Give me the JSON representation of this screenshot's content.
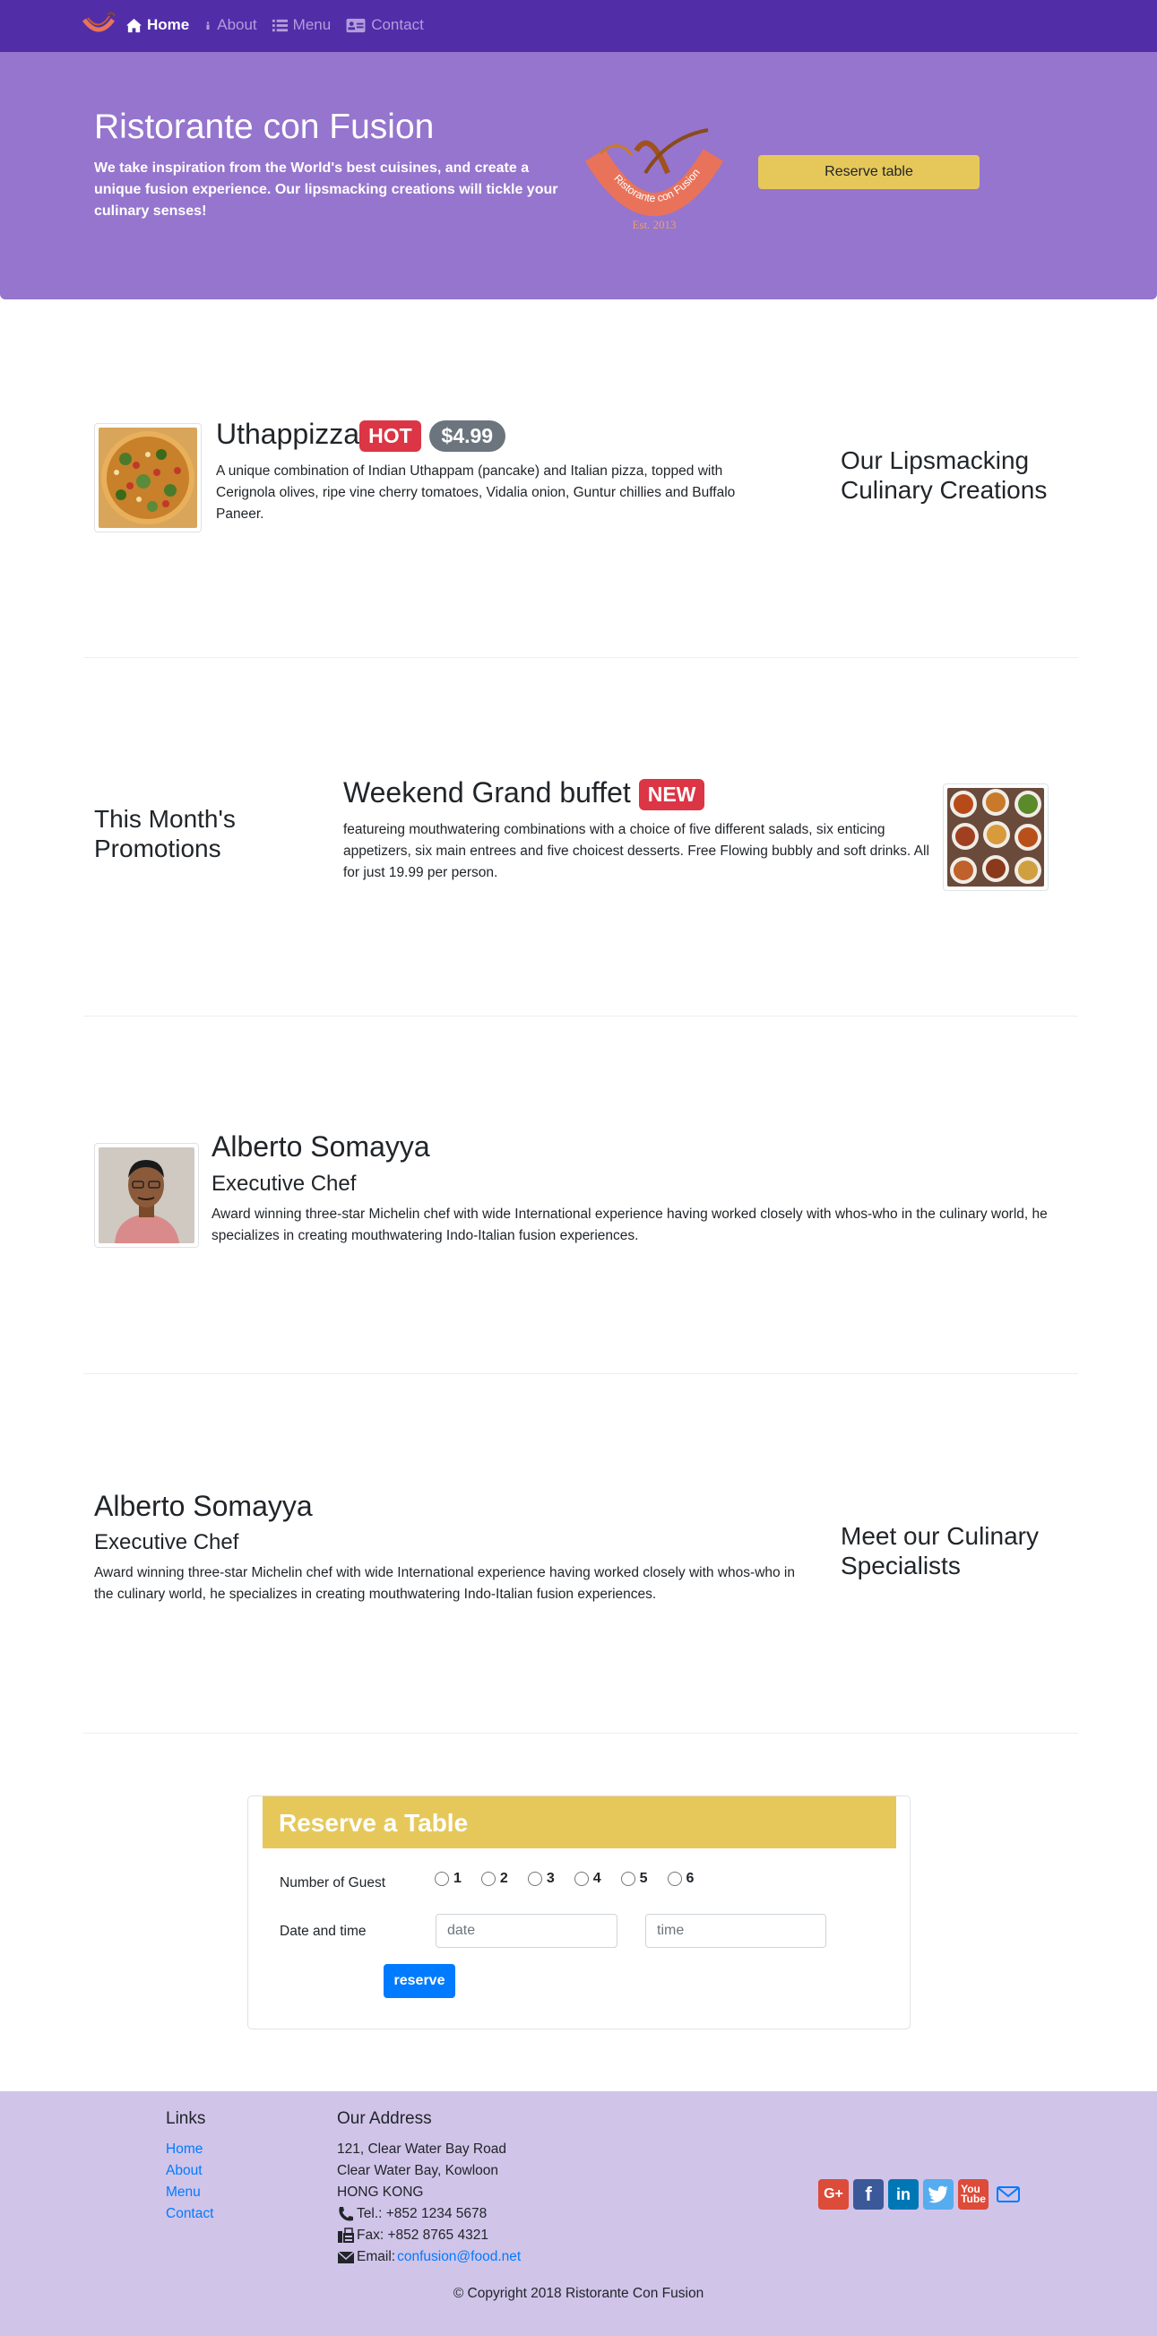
{
  "nav": {
    "items": [
      {
        "label": "Home",
        "icon": "home-icon"
      },
      {
        "label": "About",
        "icon": "info-icon"
      },
      {
        "label": "Menu",
        "icon": "list-icon"
      },
      {
        "label": "Contact",
        "icon": "address-card-icon"
      }
    ]
  },
  "jumbotron": {
    "title": "Ristorante con Fusion",
    "text": "We take inspiration from the World's best cuisines, and create a unique fusion experience. Our lipsmacking creations will tickle your culinary senses!",
    "logo_text": "Ristorante con Fusion",
    "logo_est": "Est. 2013",
    "reserve_label": "Reserve table"
  },
  "dish": {
    "name": "Uthappizza",
    "badge": "HOT",
    "price": "$4.99",
    "description": "A unique combination of Indian Uthappam (pancake) and Italian pizza, topped with Cerignola olives, ripe vine cherry tomatoes, Vidalia onion, Guntur chillies and Buffalo Paneer.",
    "side_heading": "Our Lipsmacking Culinary Creations"
  },
  "promotion": {
    "side_heading": "This Month's Promotions",
    "name": "Weekend Grand buffet",
    "badge": "NEW",
    "description": "featureing mouthwatering combinations with a choice of five different salads, six enticing appetizers, six main entrees and five choicest desserts. Free Flowing bubbly and soft drinks. All for just 19.99 per person."
  },
  "leader": {
    "name": "Alberto Somayya",
    "designation": "Executive Chef",
    "description": "Award winning three-star Michelin chef with wide International experience having worked closely with whos-who in the culinary world, he specializes in creating mouthwatering Indo-Italian fusion experiences."
  },
  "leader2": {
    "name": "Alberto Somayya",
    "designation": "Executive Chef",
    "description": "Award winning three-star Michelin chef with wide International experience having worked closely with whos-who in the culinary world, he specializes in creating mouthwatering Indo-Italian fusion experiences.",
    "side_heading": "Meet our Culinary Specialists"
  },
  "reserve_form": {
    "title": "Reserve a Table",
    "guests_label": "Number of Guest",
    "guest_options": [
      "1",
      "2",
      "3",
      "4",
      "5",
      "6"
    ],
    "datetime_label": "Date and time",
    "date_placeholder": "date",
    "time_placeholder": "time",
    "submit_label": "reserve"
  },
  "footer": {
    "links_heading": "Links",
    "links": [
      "Home",
      "About",
      "Menu",
      "Contact"
    ],
    "address_heading": "Our Address",
    "address_lines": [
      "121, Clear Water Bay Road",
      "Clear Water Bay, Kowloon",
      "HONG KONG"
    ],
    "tel": "Tel.: +852 1234 5678",
    "fax": "Fax: +852 8765 4321",
    "email_label": "Email: ",
    "email": "confusion@food.net",
    "social": [
      "google-plus-icon",
      "facebook-icon",
      "linkedin-icon",
      "twitter-icon",
      "youtube-icon",
      "envelope-icon"
    ],
    "copyright": "© Copyright 2018 Ristorante Con Fusion"
  },
  "colors": {
    "navbar": "#512da8",
    "jumbotron": "#9575cd",
    "footer": "#d1c4e9",
    "accent_yellow": "#e6c85a",
    "badge_red": "#dc3545",
    "badge_grey": "#6c757d",
    "link_blue": "#007bff"
  }
}
